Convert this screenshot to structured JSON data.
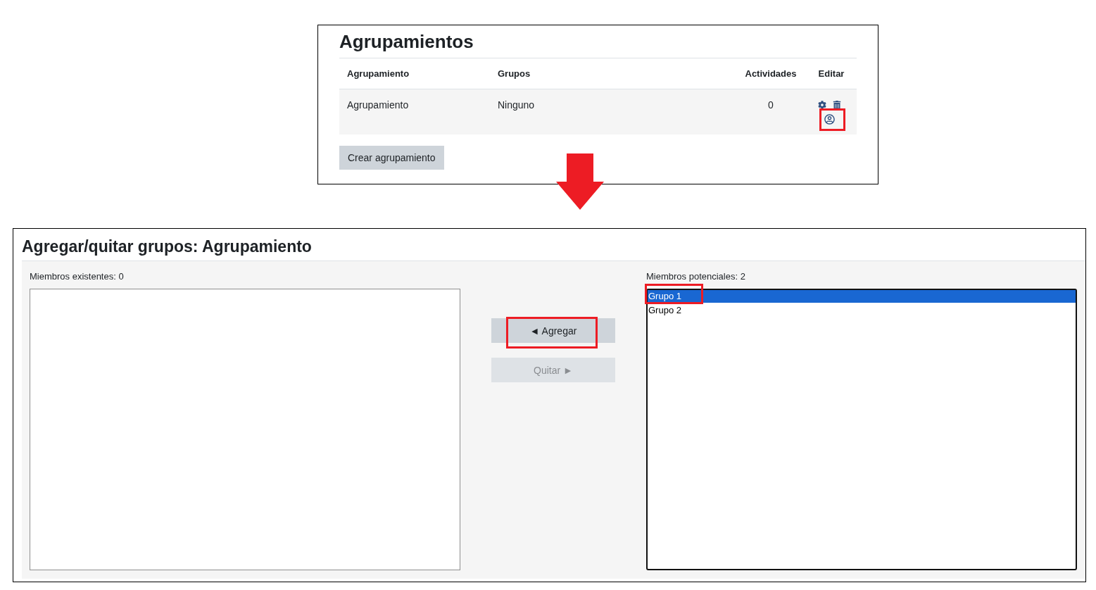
{
  "grouping_panel": {
    "title": "Agrupamientos",
    "table": {
      "columns": [
        "Agrupamiento",
        "Grupos",
        "Actividades",
        "Editar"
      ],
      "rows": [
        {
          "cells": [
            "Agrupamiento",
            "Ninguno",
            "0"
          ],
          "actions": [
            {
              "kind": "settings",
              "highlighted": false
            },
            {
              "kind": "delete",
              "highlighted": false
            },
            {
              "kind": "members",
              "highlighted": true
            }
          ]
        }
      ]
    },
    "create_button": "Crear agrupamiento"
  },
  "groups_panel": {
    "title": "Agregar/quitar grupos: Agrupamiento",
    "existing": {
      "label": "Miembros existentes: 0",
      "focused": false
    },
    "buttons": [
      {
        "label": "◄ Agregar",
        "disabled": false,
        "highlighted": true
      },
      {
        "label": "Quitar ►",
        "disabled": true,
        "highlighted": false
      }
    ],
    "potential": {
      "label": "Miembros potenciales: 2",
      "focused": true,
      "options": [
        {
          "label": "Grupo 1",
          "selected": true,
          "highlighted": true
        },
        {
          "label": "Grupo 2",
          "selected": false,
          "highlighted": false
        }
      ]
    }
  }
}
